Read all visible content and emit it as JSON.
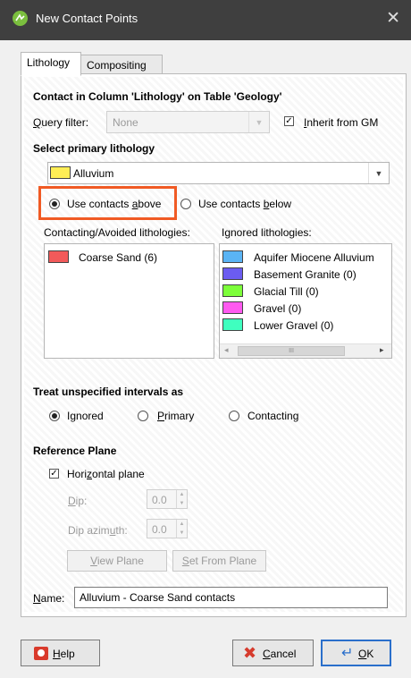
{
  "window": {
    "title": "New Contact Points",
    "close_glyph": "✕"
  },
  "tabs": [
    {
      "label": "Lithology"
    },
    {
      "label": "Compositing"
    }
  ],
  "section_contact": {
    "heading": "Contact in Column 'Lithology' on Table 'Geology'"
  },
  "query_filter": {
    "label_pre": "",
    "label_u": "Q",
    "label_post": "uery filter:",
    "value": "None"
  },
  "inherit": {
    "label_pre": "",
    "label_u": "I",
    "label_post": "nherit from GM",
    "checked": true
  },
  "primary": {
    "heading": "Select primary lithology",
    "value": "Alluvium",
    "color": "#ffee55"
  },
  "contacts_above": {
    "label_pre": "Use contacts ",
    "label_u": "a",
    "label_post": "bove"
  },
  "contacts_below": {
    "label_pre": "Use contacts ",
    "label_u": "b",
    "label_post": "elow"
  },
  "contacting": {
    "label": "Contacting/Avoided lithologies:",
    "items": [
      {
        "name": "Coarse Sand (6)",
        "color": "#f25a5a"
      }
    ]
  },
  "ignored": {
    "label": "Ignored lithologies:",
    "items": [
      {
        "name": "Aquifer Miocene Alluvium",
        "color": "#5ab4f5"
      },
      {
        "name": "Basement Granite (0)",
        "color": "#6b5cf0"
      },
      {
        "name": "Glacial Till (0)",
        "color": "#7dff3a"
      },
      {
        "name": "Gravel (0)",
        "color": "#ff5af0"
      },
      {
        "name": "Lower Gravel (0)",
        "color": "#3fffbf"
      }
    ],
    "scroll_thumb": "III"
  },
  "unspecified": {
    "heading": "Treat unspecified intervals as",
    "opt_ignored": {
      "pre": "I",
      "u": "g",
      "post": "nored"
    },
    "opt_primary": {
      "pre": "",
      "u": "P",
      "post": "rimary"
    },
    "opt_contacting": {
      "pre": "Contacting",
      "u": "",
      "post": ""
    }
  },
  "reference_plane": {
    "heading": "Reference Plane",
    "horizontal": {
      "pre": "Hori",
      "u": "z",
      "post": "ontal plane",
      "checked": true
    },
    "dip": {
      "label_pre": "",
      "label_u": "D",
      "label_post": "ip:",
      "value": "0.0"
    },
    "dip_azimuth": {
      "label_pre": "Dip azim",
      "label_u": "u",
      "label_post": "th:",
      "value": "0.0"
    },
    "view_plane": {
      "pre": "",
      "u": "V",
      "post": "iew Plane"
    },
    "set_from_plane": {
      "pre": "",
      "u": "S",
      "post": "et From Plane"
    }
  },
  "name": {
    "label_pre": "",
    "label_u": "N",
    "label_post": "ame:",
    "value": "Alluvium - Coarse Sand contacts"
  },
  "footer": {
    "help": {
      "pre": "",
      "u": "H",
      "post": "elp"
    },
    "cancel": {
      "pre": "",
      "u": "C",
      "post": "ancel"
    },
    "ok": {
      "pre": "",
      "u": "O",
      "post": "K"
    }
  },
  "colors": {
    "highlight": "#f05a24",
    "titlebar": "#3f3f3f",
    "ok_border": "#2a6fcb"
  }
}
